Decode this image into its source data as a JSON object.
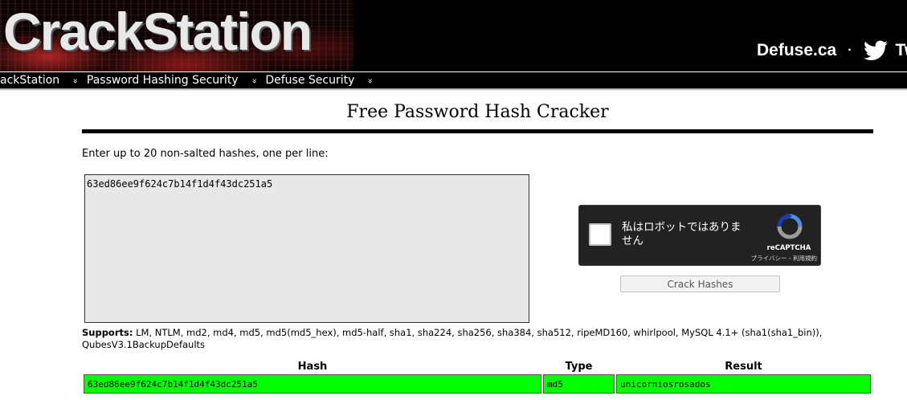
{
  "header": {
    "logo_text": "CrackStation",
    "site_link": "Defuse.ca",
    "separator": "·",
    "twitter_text": "Tw"
  },
  "nav": {
    "items": [
      {
        "label": "ackStation"
      },
      {
        "label": "Password Hashing Security"
      },
      {
        "label": "Defuse Security"
      }
    ],
    "chevron": "»"
  },
  "main": {
    "title": "Free Password Hash Cracker",
    "instructions": "Enter up to 20 non-salted hashes, one per line:",
    "textarea_value": "63ed86ee9f624c7b14f1d4f43dc251a5",
    "crack_button_label": "Crack Hashes",
    "supports_label": "Supports:",
    "supports_text": " LM, NTLM, md2, md4, md5, md5(md5_hex), md5-half, sha1, sha224, sha256, sha384, sha512, ripeMD160, whirlpool, MySQL 4.1+ (sha1(sha1_bin)), QubesV3.1BackupDefaults"
  },
  "recaptcha": {
    "label": "私はロボットではありません",
    "brand": "reCAPTCHA",
    "terms": "プライバシー - 利用規約"
  },
  "results": {
    "headers": {
      "hash": "Hash",
      "type": "Type",
      "result": "Result"
    },
    "rows": [
      {
        "hash": "63ed86ee9f624c7b14f1d4f43dc251a5",
        "type": "md5",
        "result": "unicorniosrosados"
      }
    ],
    "match_color": "#00ff00"
  },
  "colors": {
    "header_bg": "#000000",
    "accent_red": "#b01e1e"
  }
}
